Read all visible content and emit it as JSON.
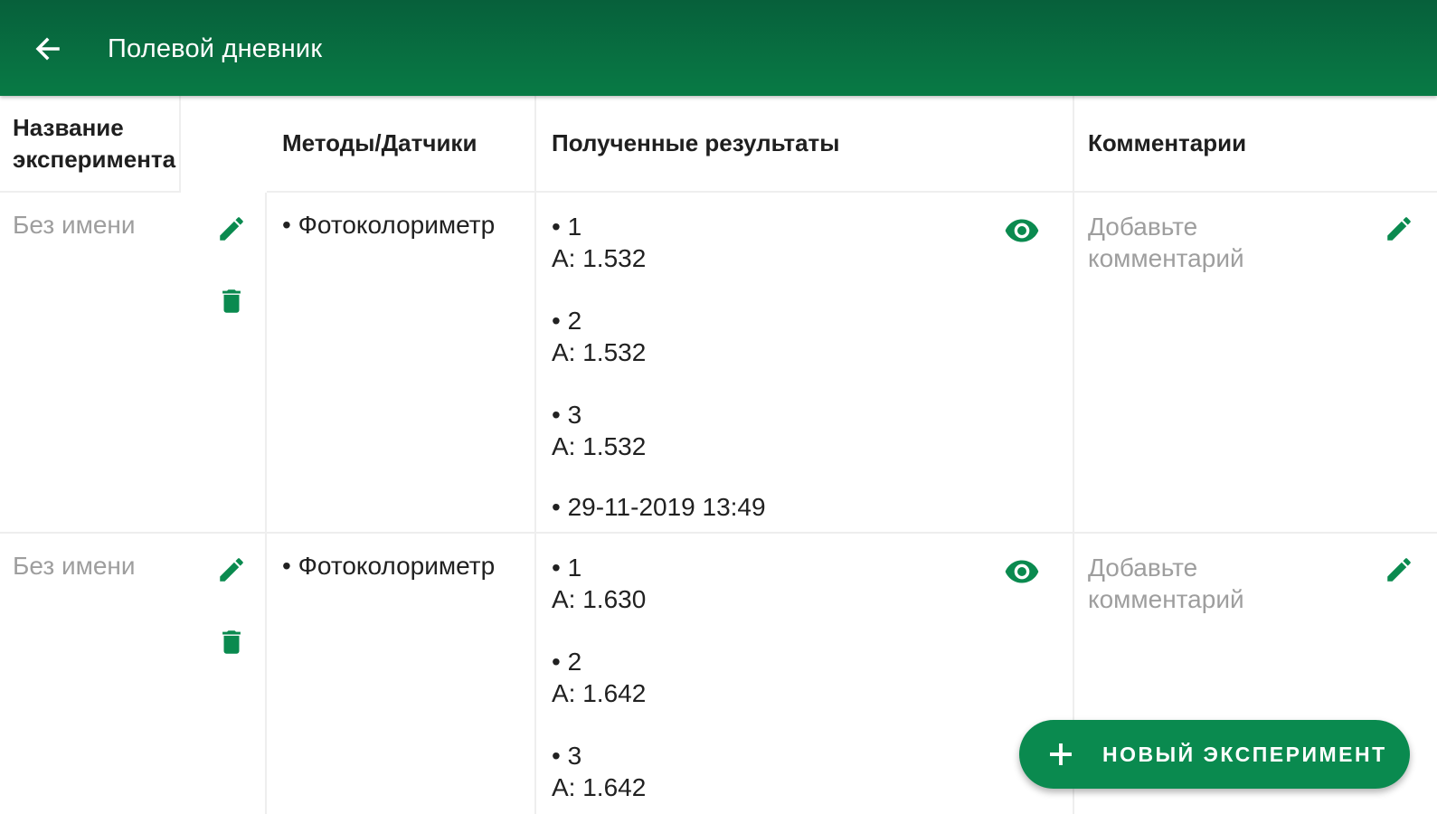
{
  "appbar": {
    "title": "Полевой дневник",
    "back_icon": "arrow-back-icon",
    "color": "#087a45"
  },
  "table": {
    "headers": [
      "Название эксперимента",
      "Методы/Датчики",
      "Полученные результаты",
      "Комментарии"
    ],
    "rows": [
      {
        "name": "Без имени",
        "method": "• Фотоколориметр",
        "results": [
          {
            "index": "• 1",
            "value": "A: 1.532"
          },
          {
            "index": "• 2",
            "value": "A: 1.532"
          },
          {
            "index": "• 3",
            "value": "A: 1.532"
          }
        ],
        "date": "• 29-11-2019 13:49",
        "comment": "Добавьте комментарий"
      },
      {
        "name": "Без имени",
        "method": "• Фотоколориметр",
        "results": [
          {
            "index": "• 1",
            "value": "A: 1.630"
          },
          {
            "index": "• 2",
            "value": "A: 1.642"
          },
          {
            "index": "• 3",
            "value": "A: 1.642"
          }
        ],
        "comment": "Добавьте комментарий"
      }
    ]
  },
  "fab": {
    "label": "НОВЫЙ ЭКСПЕРИМЕНТ",
    "icon": "plus-icon"
  },
  "colors": {
    "accent": "#0a8a4f",
    "muted_text": "#9e9e9e"
  }
}
